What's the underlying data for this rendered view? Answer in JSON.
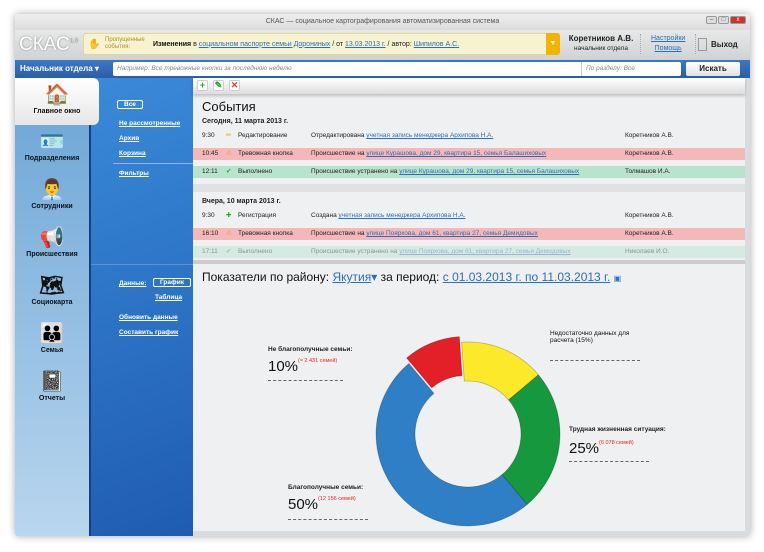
{
  "window": {
    "title": "СКАС — социальное картографирования автоматизированная система"
  },
  "header": {
    "logo": "СКАС",
    "version": "1.0",
    "missed_label": "Пропущенные события:",
    "notice_bold": "Изменения",
    "notice_pre": " в ",
    "notice_link": "социальном паспорте семьи Дорониных",
    "notice_mid": " / от ",
    "notice_date": "13.03.2013 г.",
    "notice_author_pre": " / автор: ",
    "notice_author": "Шипилов А.С.",
    "user_name": "Коретников А.В.",
    "user_role": "начальник отдела",
    "settings": "Настройки",
    "help": "Помощь",
    "exit": "Выход"
  },
  "search": {
    "role": "Начальник отдела",
    "placeholder": "Например: Все тревожные кнопки за последнюю неделю",
    "section": "По разделу: Все",
    "button": "Искать"
  },
  "sidebar": {
    "items": [
      {
        "label": "Главное окно",
        "icon": "home-icon",
        "glyph": "🏠"
      },
      {
        "label": "Подразделения",
        "icon": "id-card-icon",
        "glyph": "🪪"
      },
      {
        "label": "Сотрудники",
        "icon": "employee-icon",
        "glyph": "👨‍💼"
      },
      {
        "label": "Происшествия",
        "icon": "megaphone-icon",
        "glyph": "📢"
      },
      {
        "label": "Социокарта",
        "icon": "map-icon",
        "glyph": "🗺"
      },
      {
        "label": "Семья",
        "icon": "family-icon",
        "glyph": "👪"
      },
      {
        "label": "Отчеты",
        "icon": "notebook-icon",
        "glyph": "📓"
      }
    ]
  },
  "subnav": {
    "all": "Все",
    "unreviewed": "Не рассмотренные",
    "archive": "Архив",
    "trash": "Корзина",
    "filters": "Фильтры",
    "data_label": "Данные:",
    "chart": "График",
    "table": "Таблица",
    "refresh": "Обновить данные",
    "build_chart": "Составить график"
  },
  "events": {
    "title": "События",
    "days": [
      {
        "label": "Сегодня, 11 марта 2013 г.",
        "rows": [
          {
            "time": "9:30",
            "type": "Редактирование",
            "kind": "edit",
            "text": "Отредактирована ",
            "link": "учетная запись менеджера Архипова Н.А.",
            "user": "Коретников А.В."
          },
          {
            "time": "10:45",
            "type": "Тревожная кнопка",
            "kind": "alarm",
            "text": "Происшествие на ",
            "link": "улице Курашова, дом 29, квартира 15, семья Балашиховых",
            "user": "Коретников А.В."
          },
          {
            "time": "12:11",
            "type": "Выполнено",
            "kind": "ok",
            "text": "Происшествие  устранено на ",
            "link": "улице Курашова, дом 29, квартира 15, семья Балашиховых",
            "user": "Толмашов И.А."
          }
        ]
      },
      {
        "label": "Вчера, 10 марта 2013 г.",
        "rows": [
          {
            "time": "9:30",
            "type": "Регистрация",
            "kind": "reg",
            "text": "Создана ",
            "link": "учетная запись менеджера Архипова Н.А.",
            "user": "Коретников А.В."
          },
          {
            "time": "16:10",
            "type": "Тревожная кнопка",
            "kind": "alarm",
            "text": "Происшествие на ",
            "link": "улице Поярковa, дом 61, квартира 27, семья Демидовых",
            "user": "Коретников А.В."
          },
          {
            "time": "17:11",
            "type": "Выполнено",
            "kind": "ok",
            "text": "Происшествие  устранено на ",
            "link": "улице Пояркова, дом 61, квартира 27, семья Демидовых",
            "user": "Николаев И.О."
          }
        ]
      }
    ]
  },
  "indicators": {
    "prefix": "Показатели по району: ",
    "region": "Якутия",
    "mid": " за период: ",
    "period": "с 01.03.2013 г. по 11.03.2013 г."
  },
  "chart_data": {
    "type": "pie",
    "donut": true,
    "slices": [
      {
        "label": "Не благополучные семьи:",
        "value": 10,
        "pct_text": "10%",
        "note": "(≈ 2 431 семей)",
        "color": "#e32028"
      },
      {
        "label": "Недостаточно данных для расчета (15%)",
        "value": 15,
        "pct_text": "",
        "note": "",
        "color": "#fbe92a"
      },
      {
        "label": "Трудная жизненная ситуация:",
        "value": 25,
        "pct_text": "25%",
        "note": "(6 078 семей)",
        "color": "#16983f"
      },
      {
        "label": "Благополучные семьи:",
        "value": 50,
        "pct_text": "50%",
        "note": "(12 156 семей)",
        "color": "#2f7fc6"
      }
    ]
  }
}
